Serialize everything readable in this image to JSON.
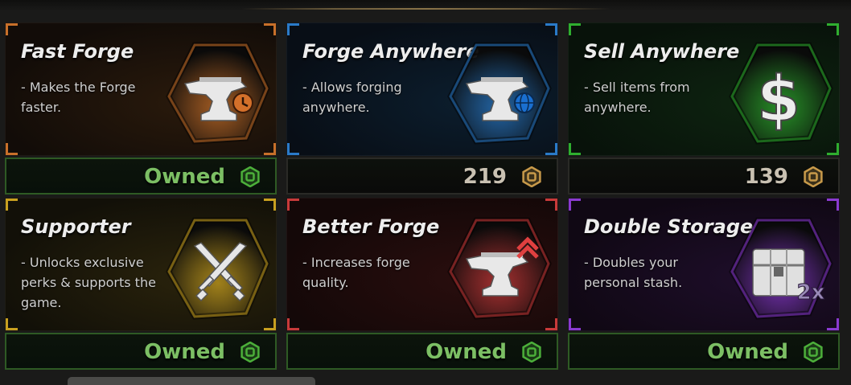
{
  "cards": [
    {
      "title": "Fast Forge",
      "desc": "- Makes the Forge faster.",
      "price": "Owned",
      "owned": true,
      "icon": "anvil-clock-icon",
      "accent": "#c8702a"
    },
    {
      "title": "Forge Anywhere",
      "desc": "- Allows forging anywhere.",
      "price": "219",
      "owned": false,
      "icon": "anvil-globe-icon",
      "accent": "#2a7ac8"
    },
    {
      "title": "Sell Anywhere",
      "desc": "- Sell items from anywhere.",
      "price": "139",
      "owned": false,
      "icon": "dollar-icon",
      "accent": "#2fae2f"
    },
    {
      "title": "Supporter",
      "desc": "- Unlocks exclusive perks & supports the game.",
      "price": "Owned",
      "owned": true,
      "icon": "crossed-swords-icon",
      "accent": "#c8a020"
    },
    {
      "title": "Better Forge",
      "desc": "- Increases forge quality.",
      "price": "Owned",
      "owned": true,
      "icon": "anvil-chevron-icon",
      "accent": "#c83a3a"
    },
    {
      "title": "Double Storage",
      "desc": "- Doubles your personal stash.",
      "price": "Owned",
      "owned": true,
      "icon": "chest-2x-icon",
      "accent": "#8a3ad0"
    }
  ],
  "currency_icon": "robux-coin-icon",
  "colors": {
    "owned": "#7cbf64",
    "price": "#c9c1b2",
    "owned_border": "#2e5a24"
  }
}
